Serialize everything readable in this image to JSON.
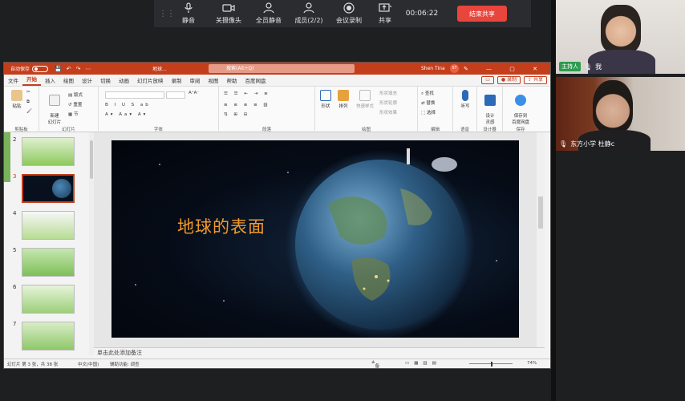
{
  "meeting_toolbar": {
    "mute": "静音",
    "camera_off": "关摄像头",
    "mute_all": "全员静音",
    "members": "成员(2/2)",
    "record": "会议录制",
    "share": "共享",
    "timer": "00:06:22",
    "end_share": "结束共享"
  },
  "ppt": {
    "title": {
      "autosave": "自动保存",
      "doc_name": "地球...",
      "search": "搜索(Alt+Q)",
      "user": "Shen Tina",
      "user_initials": "ST"
    },
    "tabs": [
      "文件",
      "开始",
      "插入",
      "绘图",
      "设计",
      "切换",
      "动画",
      "幻灯片放映",
      "录制",
      "审阅",
      "视图",
      "帮助",
      "百度网盘"
    ],
    "active_tab": "开始",
    "tab_right": {
      "record": "录制",
      "share": "共享"
    },
    "ribbon": {
      "paste": "粘贴",
      "clipboard": "剪贴板",
      "new_slide": "新建\n幻灯片",
      "layout": "版式",
      "reset": "重置",
      "section": "节",
      "slides": "幻灯片",
      "font": "字体",
      "paragraph": "段落",
      "shapes": "形状",
      "arrange": "排列",
      "quick_styles": "快速样式",
      "shape_fill": "形状填充",
      "shape_outline": "形状轮廓",
      "shape_effects": "形状效果",
      "drawing": "绘图",
      "find": "查找",
      "replace": "替换",
      "select": "选择",
      "editing": "编辑",
      "dictate": "听写",
      "voice": "语音",
      "designer": "设计\n灵感",
      "designer_group": "设计器",
      "save_baidu": "保存到\n百度网盘",
      "save_group": "保存"
    },
    "thumbnails": [
      {
        "num": "2",
        "selected": false
      },
      {
        "num": "3",
        "selected": true
      },
      {
        "num": "4",
        "selected": false
      },
      {
        "num": "5",
        "selected": false
      },
      {
        "num": "6",
        "selected": false
      },
      {
        "num": "7",
        "selected": false
      }
    ],
    "slide": {
      "title": "地球的表面"
    },
    "notes_placeholder": "单击此处添加备注",
    "status": {
      "slide_info": "幻灯片 第 3 张，共 38 张",
      "language": "中文(中国)",
      "accessibility": "辅助功能: 调查",
      "notes": "备注",
      "zoom": "74%"
    }
  },
  "participants": [
    {
      "name": "我",
      "badge": "主持人"
    },
    {
      "name": "东方小学 杜静c"
    }
  ],
  "colors": {
    "ppt_accent": "#c43e1c",
    "end_button": "#e8453c",
    "host_badge": "#2e9c4e",
    "slide_title": "#f09a2c"
  }
}
